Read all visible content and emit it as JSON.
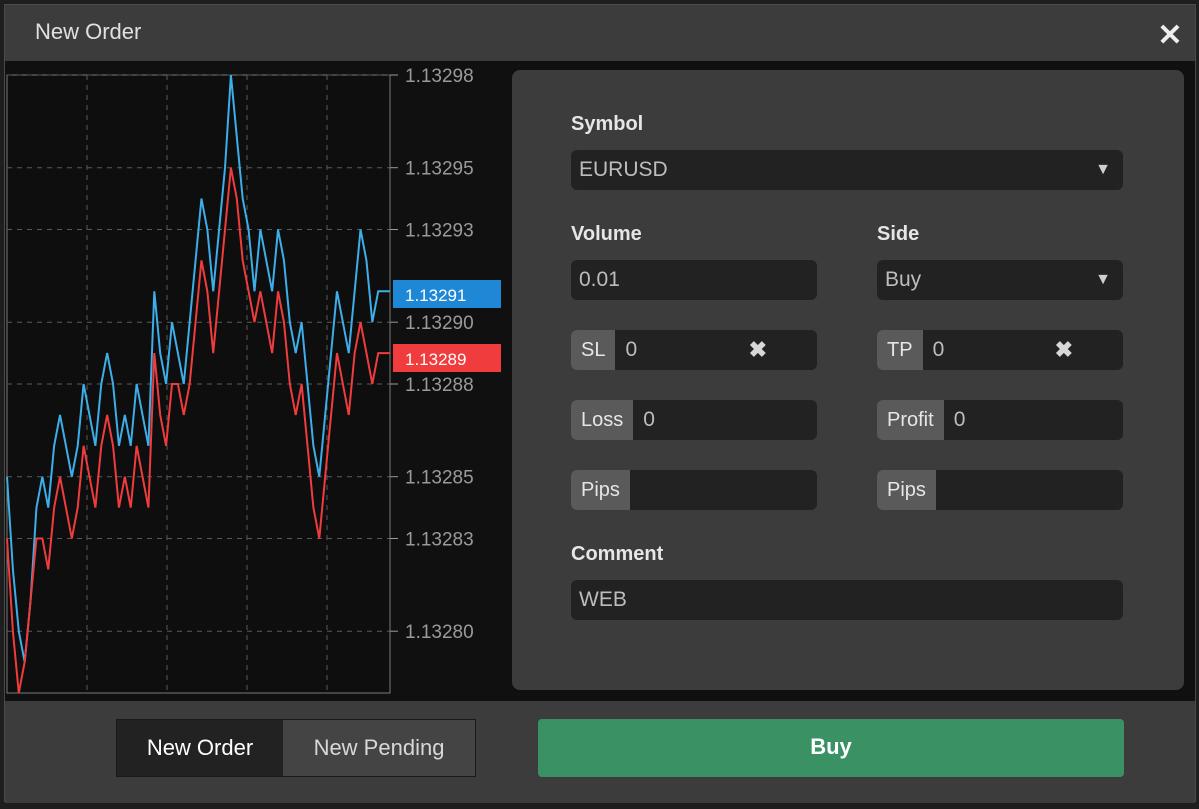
{
  "title": "New Order",
  "close_icon": "close-icon",
  "chart_data": {
    "type": "line",
    "y_ticks": [
      "1.13298",
      "1.13295",
      "1.13293",
      "1.13290",
      "1.13288",
      "1.13285",
      "1.13283",
      "1.13280"
    ],
    "ylim": [
      1.13278,
      1.13298
    ],
    "grid": true,
    "ask_label": "1.13291",
    "bid_label": "1.13289",
    "colors": {
      "ask": "#3daee9",
      "bid": "#f03c3c",
      "ask_label_bg": "#1e88d6",
      "bid_label_bg": "#f03c3c"
    },
    "series": [
      {
        "color": "#3daee9",
        "values": [
          1.13285,
          1.13282,
          1.1328,
          1.13279,
          1.13281,
          1.13284,
          1.13285,
          1.13284,
          1.13286,
          1.13287,
          1.13286,
          1.13285,
          1.13286,
          1.13288,
          1.13287,
          1.13286,
          1.13288,
          1.13289,
          1.13288,
          1.13286,
          1.13287,
          1.13286,
          1.13288,
          1.13287,
          1.13286,
          1.13291,
          1.13289,
          1.13288,
          1.1329,
          1.13289,
          1.13288,
          1.1329,
          1.13292,
          1.13294,
          1.13293,
          1.13291,
          1.13293,
          1.13295,
          1.13298,
          1.13296,
          1.13294,
          1.13293,
          1.13291,
          1.13293,
          1.13292,
          1.13291,
          1.13293,
          1.13292,
          1.1329,
          1.13289,
          1.1329,
          1.13288,
          1.13286,
          1.13285,
          1.13287,
          1.13289,
          1.13291,
          1.1329,
          1.13289,
          1.13291,
          1.13293,
          1.13292,
          1.1329,
          1.13291,
          1.13291,
          1.13291
        ]
      },
      {
        "color": "#f03c3c",
        "values": [
          1.13283,
          1.1328,
          1.13278,
          1.13279,
          1.13281,
          1.13283,
          1.13283,
          1.13282,
          1.13284,
          1.13285,
          1.13284,
          1.13283,
          1.13284,
          1.13286,
          1.13285,
          1.13284,
          1.13286,
          1.13287,
          1.13286,
          1.13284,
          1.13285,
          1.13284,
          1.13286,
          1.13285,
          1.13284,
          1.13289,
          1.13287,
          1.13286,
          1.13288,
          1.13288,
          1.13287,
          1.13288,
          1.1329,
          1.13292,
          1.13291,
          1.13289,
          1.13291,
          1.13293,
          1.13295,
          1.13294,
          1.13292,
          1.13291,
          1.1329,
          1.13291,
          1.1329,
          1.13289,
          1.13291,
          1.1329,
          1.13288,
          1.13287,
          1.13288,
          1.13286,
          1.13284,
          1.13283,
          1.13285,
          1.13287,
          1.13289,
          1.13288,
          1.13287,
          1.13289,
          1.1329,
          1.13289,
          1.13288,
          1.13289,
          1.13289,
          1.13289
        ]
      }
    ]
  },
  "form": {
    "symbol_label": "Symbol",
    "symbol_value": "EURUSD",
    "volume_label": "Volume",
    "volume_value": "0.01",
    "side_label": "Side",
    "side_value": "Buy",
    "sl_addon": "SL",
    "sl_value": "0",
    "tp_addon": "TP",
    "tp_value": "0",
    "loss_addon": "Loss",
    "loss_value": "0",
    "profit_addon": "Profit",
    "profit_value": "0",
    "pips_addon_left": "Pips",
    "pips_addon_right": "Pips",
    "comment_label": "Comment",
    "comment_value": "WEB",
    "dropdown_icon": "triangle-down-icon",
    "clear_icon": "clear-x-icon"
  },
  "footer": {
    "tabs": [
      {
        "label": "New Order",
        "active": true
      },
      {
        "label": "New Pending",
        "active": false
      }
    ],
    "buy_label": "Buy"
  }
}
